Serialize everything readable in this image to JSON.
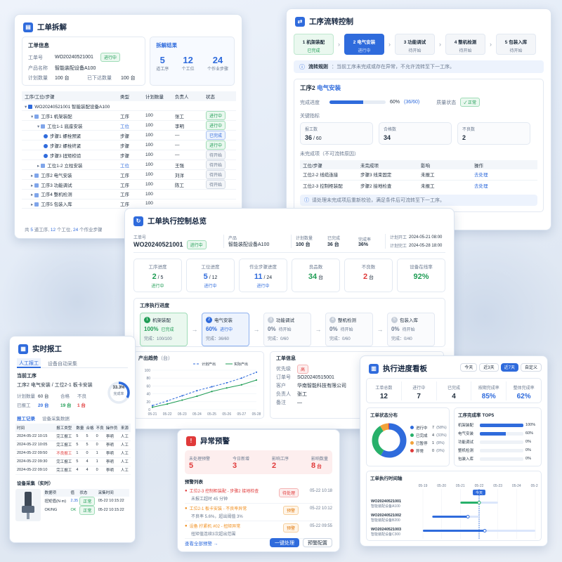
{
  "wo_split": {
    "title": "工单拆解",
    "info_title": "工单信息",
    "fields": [
      {
        "label": "工单号",
        "value": "WO20240521001"
      },
      {
        "label": "产品名称",
        "value": "智能装配设备A100"
      },
      {
        "label": "计划数量",
        "value": "100 台"
      }
    ],
    "status": "进行中",
    "issued_label": "已下达数量",
    "issued_value": "100 台",
    "result_title": "拆解结果",
    "results": [
      {
        "value": "5",
        "label": "道工序"
      },
      {
        "value": "12",
        "label": "个工位"
      },
      {
        "value": "24",
        "label": "个作业步骤"
      }
    ],
    "headers": [
      "工序/工位/步骤",
      "类型",
      "计划数量",
      "负责人",
      "状态"
    ],
    "rows": [
      {
        "name": "WO20240521001 智能装配设备A100",
        "type": "",
        "qty": "",
        "owner": "",
        "status": "",
        "level": 0
      },
      {
        "name": "工序1 机架装配",
        "type": "工序",
        "qty": "100",
        "owner": "张工",
        "status": "进行中",
        "level": 1
      },
      {
        "name": "工位1-1 底座安装",
        "type": "工位",
        "qty": "100",
        "owner": "李明",
        "status": "进行中",
        "level": 2
      },
      {
        "name": "步骤1 螺栓预紧",
        "type": "步骤",
        "qty": "100",
        "owner": "—",
        "status": "已完成",
        "level": 3
      },
      {
        "name": "步骤2 螺栓终紧",
        "type": "步骤",
        "qty": "100",
        "owner": "—",
        "status": "进行中",
        "level": 3
      },
      {
        "name": "步骤3 扭矩校验",
        "type": "步骤",
        "qty": "100",
        "owner": "—",
        "status": "待开始",
        "level": 3
      },
      {
        "name": "工位1-2 立柱安装",
        "type": "工位",
        "qty": "100",
        "owner": "王强",
        "status": "待开始",
        "level": 2
      },
      {
        "name": "工序2 电气安装",
        "type": "工序",
        "qty": "100",
        "owner": "刘洋",
        "status": "待开始",
        "level": 1
      },
      {
        "name": "工序3 功能调试",
        "type": "工序",
        "qty": "100",
        "owner": "陈工",
        "status": "待开始",
        "level": 1
      },
      {
        "name": "工序4 整机检测",
        "type": "工序",
        "qty": "100",
        "owner": "",
        "status": "",
        "level": 1
      },
      {
        "name": "工序5 包装入库",
        "type": "工序",
        "qty": "100",
        "owner": "",
        "status": "",
        "level": 1
      }
    ],
    "footer": [
      "共 ",
      "5",
      " 道工序, ",
      "12",
      " 个工位, ",
      "24",
      " 个作业步骤"
    ]
  },
  "flow": {
    "title": "工序流转控制",
    "steps": [
      {
        "num": "1",
        "name": "机架装配",
        "status": "已完成",
        "state": "done"
      },
      {
        "num": "2",
        "name": "电气安装",
        "status": "进行中",
        "state": "active"
      },
      {
        "num": "3",
        "name": "功能调试",
        "status": "待开始",
        "state": "wait"
      },
      {
        "num": "4",
        "name": "整机检测",
        "status": "待开始",
        "state": "wait"
      },
      {
        "num": "5",
        "name": "包装入库",
        "status": "待开始",
        "state": "wait"
      }
    ],
    "rule_label": "流转规则",
    "rule_text": "：当前工序未完成或存在异常，不允许流转至下一工序。",
    "detail_prefix": "工序2",
    "detail_name": "电气安装",
    "progress_label": "完成进度",
    "progress_pct": "60%",
    "progress_frac": "(36/60)",
    "progress_value": 0.6,
    "quality_label": "质量状态",
    "quality_value": "正常",
    "kpi_title": "关键指标",
    "kpis": [
      {
        "label": "报工数",
        "value": "36",
        "sub": " / 60"
      },
      {
        "label": "合格数",
        "value": "34",
        "sub": ""
      },
      {
        "label": "不良数",
        "value": "2",
        "sub": ""
      }
    ],
    "pending_title": "未完成项（不可流转原因）",
    "pending_headers": [
      "工位/步骤",
      "未完成项",
      "影响",
      "操作"
    ],
    "pending_rows": [
      {
        "c1": "工位2-2 线缆连接",
        "c2": "步骤3 线束固定",
        "c3": "未报工",
        "c4": "去处理"
      },
      {
        "c1": "工位2-3 控制柜装配",
        "c2": "步骤2 接地检查",
        "c3": "未报工",
        "c4": "去处理"
      }
    ],
    "note": "请处理未完成项后重新校验，满足条件后可流转至下一工序。"
  },
  "overview": {
    "title": "工单执行控制总览",
    "wo_label": "工单号",
    "wo_value": "WO20240521001",
    "status": "进行中",
    "product_label": "产品",
    "product_value": "智能装配设备A100",
    "plan_label": "计划数量",
    "plan_value": "100 台",
    "done_label": "已完成",
    "done_value": "36 台",
    "rate_label": "完成率",
    "rate_value": "36%",
    "start_label": "计划开工",
    "start_value": "2024-05-21 08:00",
    "end_label": "计划完工",
    "end_value": "2024-05-28 18:00",
    "stats": [
      {
        "label": "工序进度",
        "value": "2",
        "sub": " / 5",
        "note": "进行中",
        "color": "green"
      },
      {
        "label": "工位进度",
        "value": "5",
        "sub": " / 12",
        "note": "进行中",
        "color": "blue"
      },
      {
        "label": "作业步骤进度",
        "value": "11",
        "sub": " / 24",
        "note": "进行中",
        "color": "blue"
      },
      {
        "label": "良品数",
        "value": "34",
        "sub": " 台",
        "note": "",
        "color": "green"
      },
      {
        "label": "不良数",
        "value": "2",
        "sub": " 台",
        "note": "",
        "color": "red"
      },
      {
        "label": "设备在线率",
        "value": "92%",
        "sub": "",
        "note": "",
        "color": "green"
      }
    ],
    "exec_title": "工序执行进度",
    "procs": [
      {
        "num": "1",
        "name": "机架装配",
        "pct": "100%",
        "status": "已完成",
        "done": "完成：100/100",
        "state": "done"
      },
      {
        "num": "2",
        "name": "电气安装",
        "pct": "60%",
        "status": "进行中",
        "done": "完成：36/60",
        "state": "active"
      },
      {
        "num": "3",
        "name": "功能调试",
        "pct": "0%",
        "status": "待开始",
        "done": "完成：0/60",
        "state": "wait"
      },
      {
        "num": "4",
        "name": "整机检测",
        "pct": "0%",
        "status": "待开始",
        "done": "完成：0/60",
        "state": "wait"
      },
      {
        "num": "5",
        "name": "包装入库",
        "pct": "0%",
        "status": "待开始",
        "done": "完成：0/40",
        "state": "wait"
      }
    ],
    "trend_title": "产出趋势",
    "trend_unit": "（台）",
    "wo_info_title": "工单信息",
    "wo_info": [
      {
        "label": "优先级",
        "value": "高"
      },
      {
        "label": "订单号",
        "value": "SO20240515001"
      },
      {
        "label": "客户",
        "value": "华南智能科技有限公司"
      },
      {
        "label": "负责人",
        "value": "张工"
      },
      {
        "label": "备注",
        "value": "—"
      }
    ]
  },
  "chart_data": {
    "type": "line",
    "title": "产出趋势",
    "ylabel": "（台）",
    "x": [
      "05-21",
      "05-22",
      "05-23",
      "05-24",
      "05-25",
      "05-26",
      "05-27",
      "05-28"
    ],
    "yticks": [
      "0",
      "20",
      "40",
      "60",
      "80",
      "100"
    ],
    "ylim": [
      0,
      100
    ],
    "series": [
      {
        "name": "计划产出",
        "values": [
          10,
          22,
          35,
          48,
          58,
          68,
          80,
          95
        ],
        "style": "dashed",
        "color": "#2f6bdc"
      },
      {
        "name": "实际产出",
        "values": [
          6,
          14,
          24,
          34,
          46,
          55,
          63,
          75
        ],
        "style": "solid",
        "color": "#1f9d55"
      }
    ],
    "legend": "top-right"
  },
  "report": {
    "title": "实时报工",
    "tabs": [
      "人工报工",
      "设备自动采集"
    ],
    "current_label": "当前工序",
    "current_value": "工序2 电气安装 / 工位2-1 板卡安装",
    "plan_label": "计划数量",
    "plan_value": "60 台",
    "reported_label": "已报工",
    "reported_value": "20 台",
    "good_label": "合格",
    "good_value": "19 台",
    "bad_label": "不良",
    "bad_value": "1 台",
    "donut_pct": "33.3%",
    "donut_label": "完成率",
    "donut_value": 0.333,
    "sub_tabs": [
      "报工记录",
      "设备采集数据"
    ],
    "headers": [
      "时间",
      "报工类型",
      "数量",
      "合格",
      "不良",
      "操作员",
      "来源"
    ],
    "rows": [
      {
        "time": "2024-05-22 10:15",
        "type": "完工报工",
        "qty": "5",
        "good": "5",
        "bad": "0",
        "op": "李明",
        "src": "人工",
        "bad_flag": false
      },
      {
        "time": "2024-05-22 10:05",
        "type": "完工报工",
        "qty": "5",
        "good": "5",
        "bad": "0",
        "op": "李明",
        "src": "人工",
        "bad_flag": false
      },
      {
        "time": "2024-05-22 09:50",
        "type": "不良报工",
        "qty": "1",
        "good": "0",
        "bad": "1",
        "op": "李明",
        "src": "人工",
        "bad_flag": true
      },
      {
        "time": "2024-05-22 09:30",
        "type": "完工报工",
        "qty": "5",
        "good": "4",
        "bad": "1",
        "op": "李明",
        "src": "人工",
        "bad_flag": false
      },
      {
        "time": "2024-05-22 09:10",
        "type": "完工报工",
        "qty": "4",
        "good": "4",
        "bad": "0",
        "op": "李明",
        "src": "人工",
        "bad_flag": false
      }
    ],
    "dev_title": "设备采集（实时）",
    "dev_headers": [
      "数据项",
      "值",
      "状态",
      "采集时间"
    ],
    "dev_rows": [
      {
        "k": "扭矩值(N·m)",
        "v": "2.35",
        "s": "正常",
        "t": "05-22 10:15:22"
      },
      {
        "k": "OK/NG",
        "v": "OK",
        "s": "正常",
        "t": "05-22 10:15:22"
      }
    ]
  },
  "alert": {
    "title": "异常预警",
    "stats": [
      {
        "label": "未处理预警",
        "value": "5",
        "unit": ""
      },
      {
        "label": "今日新增",
        "value": "3",
        "unit": ""
      },
      {
        "label": "影响工序",
        "value": "2",
        "unit": ""
      },
      {
        "label": "影响数量",
        "value": "8",
        "unit": " 台"
      }
    ],
    "list_title": "预警列表",
    "items": [
      {
        "title": "工位2-3 控制柜装配 - 步骤2 接地检查",
        "desc": "未报工超时 45 分钟",
        "badge": "待处理",
        "time": "05-22 10:18",
        "level": "red"
      },
      {
        "title": "工位2-1 板卡安装 - 不良率异常",
        "desc": "不良率 5.6%，超出阈值 3%",
        "badge": "预警",
        "time": "05-22 10:12",
        "level": "orange"
      },
      {
        "title": "设备 拧紧机 #02 - 扭矩异常",
        "desc": "扭矩值连续3次超出范围",
        "badge": "预警",
        "time": "05-22 09:55",
        "level": "orange"
      }
    ],
    "view_all": "查看全部预警 →",
    "handle": "一键处理",
    "config": "预警配置"
  },
  "board": {
    "title": "执行进度看板",
    "ranges": [
      "今天",
      "近3天",
      "近7天",
      "自定义"
    ],
    "active_range": 2,
    "stats": [
      {
        "label": "工单总数",
        "value": "12",
        "color": "dark"
      },
      {
        "label": "进行中",
        "value": "7",
        "color": "dark"
      },
      {
        "label": "已完成",
        "value": "4",
        "color": "dark"
      },
      {
        "label": "按期完成率",
        "value": "85%",
        "color": "blue"
      },
      {
        "label": "整体完成率",
        "value": "62%",
        "color": "blue"
      }
    ],
    "dist_title": "工单状态分布",
    "dist": [
      {
        "name": "进行中",
        "value": "7",
        "pct": "(58%)",
        "frac": 0.58,
        "color": "#2f6bdc"
      },
      {
        "name": "已完成",
        "value": "4",
        "pct": "(33%)",
        "frac": 0.33,
        "color": "#27b06a"
      },
      {
        "name": "已暂停",
        "value": "1",
        "pct": "(8%)",
        "frac": 0.08,
        "color": "#f2a23a"
      },
      {
        "name": "异常",
        "value": "0",
        "pct": "(0%)",
        "frac": 0.01,
        "color": "#e03a3a"
      }
    ],
    "top_title": "工序完成率 TOP5",
    "top": [
      {
        "name": "机架装配",
        "pct": "100%",
        "value": 1.0
      },
      {
        "name": "电气安装",
        "pct": "60%",
        "value": 0.6
      },
      {
        "name": "功能调试",
        "pct": "0%",
        "value": 0.0
      },
      {
        "name": "整机检测",
        "pct": "0%",
        "value": 0.0
      },
      {
        "name": "包装入库",
        "pct": "0%",
        "value": 0.0
      }
    ],
    "gantt_title": "工单执行时间轴",
    "gantt_dates": [
      "05-19",
      "05-20",
      "05-21",
      "05-22",
      "05-23",
      "05-24",
      "05-25"
    ],
    "today_label": "今天",
    "gantt_rows": [
      {
        "wo": "WO20240521001",
        "prod": "智能装配设备A100",
        "start": 2.0,
        "done": 3.0,
        "end": 4.0
      },
      {
        "wo": "WO20240521002",
        "prod": "智能装配设备B200",
        "start": 0.5,
        "done": 2.4,
        "end": 3.0
      },
      {
        "wo": "WO20240521003",
        "prod": "智能装配设备C300",
        "start": 0.0,
        "done": 3.3,
        "end": 6.0
      }
    ]
  }
}
